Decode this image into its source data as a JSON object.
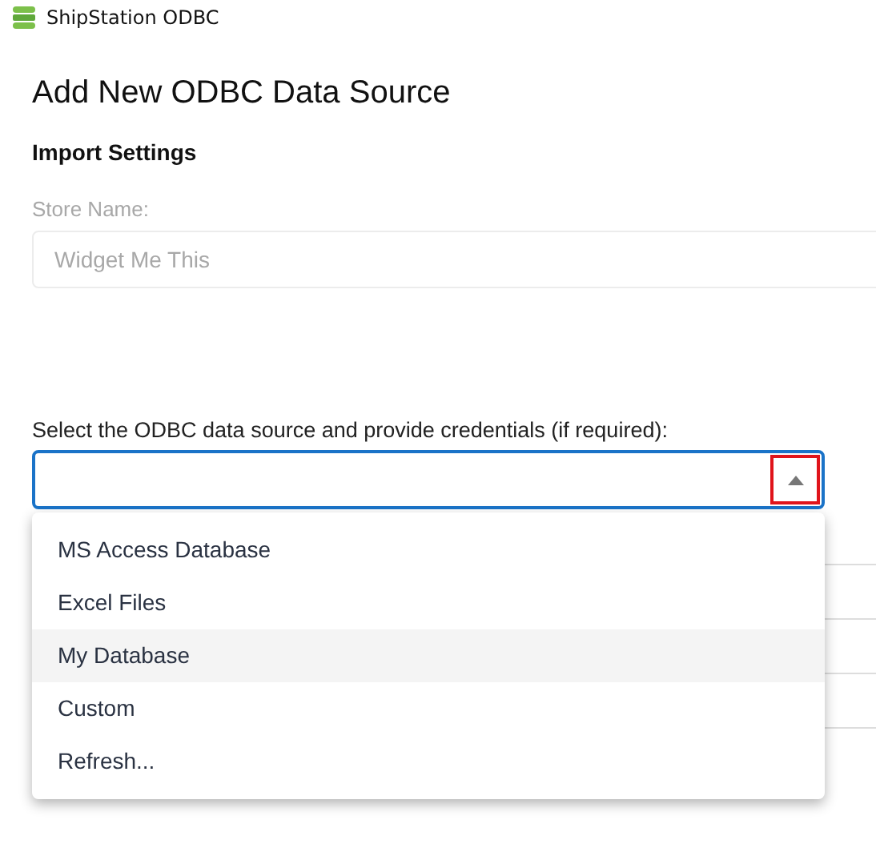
{
  "window": {
    "title": "ShipStation ODBC"
  },
  "heading": "Add New ODBC Data Source",
  "section": "Import Settings",
  "store_name": {
    "label": "Store Name:",
    "value": "Widget Me This",
    "disabled": true
  },
  "source_select": {
    "label": "Select the ODBC data source and provide credentials (if required):",
    "expanded": true,
    "toggle_outlined": true,
    "options": [
      {
        "label": "MS Access Database",
        "highlighted": false
      },
      {
        "label": "Excel Files",
        "highlighted": false
      },
      {
        "label": "My Database",
        "highlighted": true
      },
      {
        "label": "Custom",
        "highlighted": false
      },
      {
        "label": "Refresh...",
        "highlighted": false
      }
    ]
  }
}
